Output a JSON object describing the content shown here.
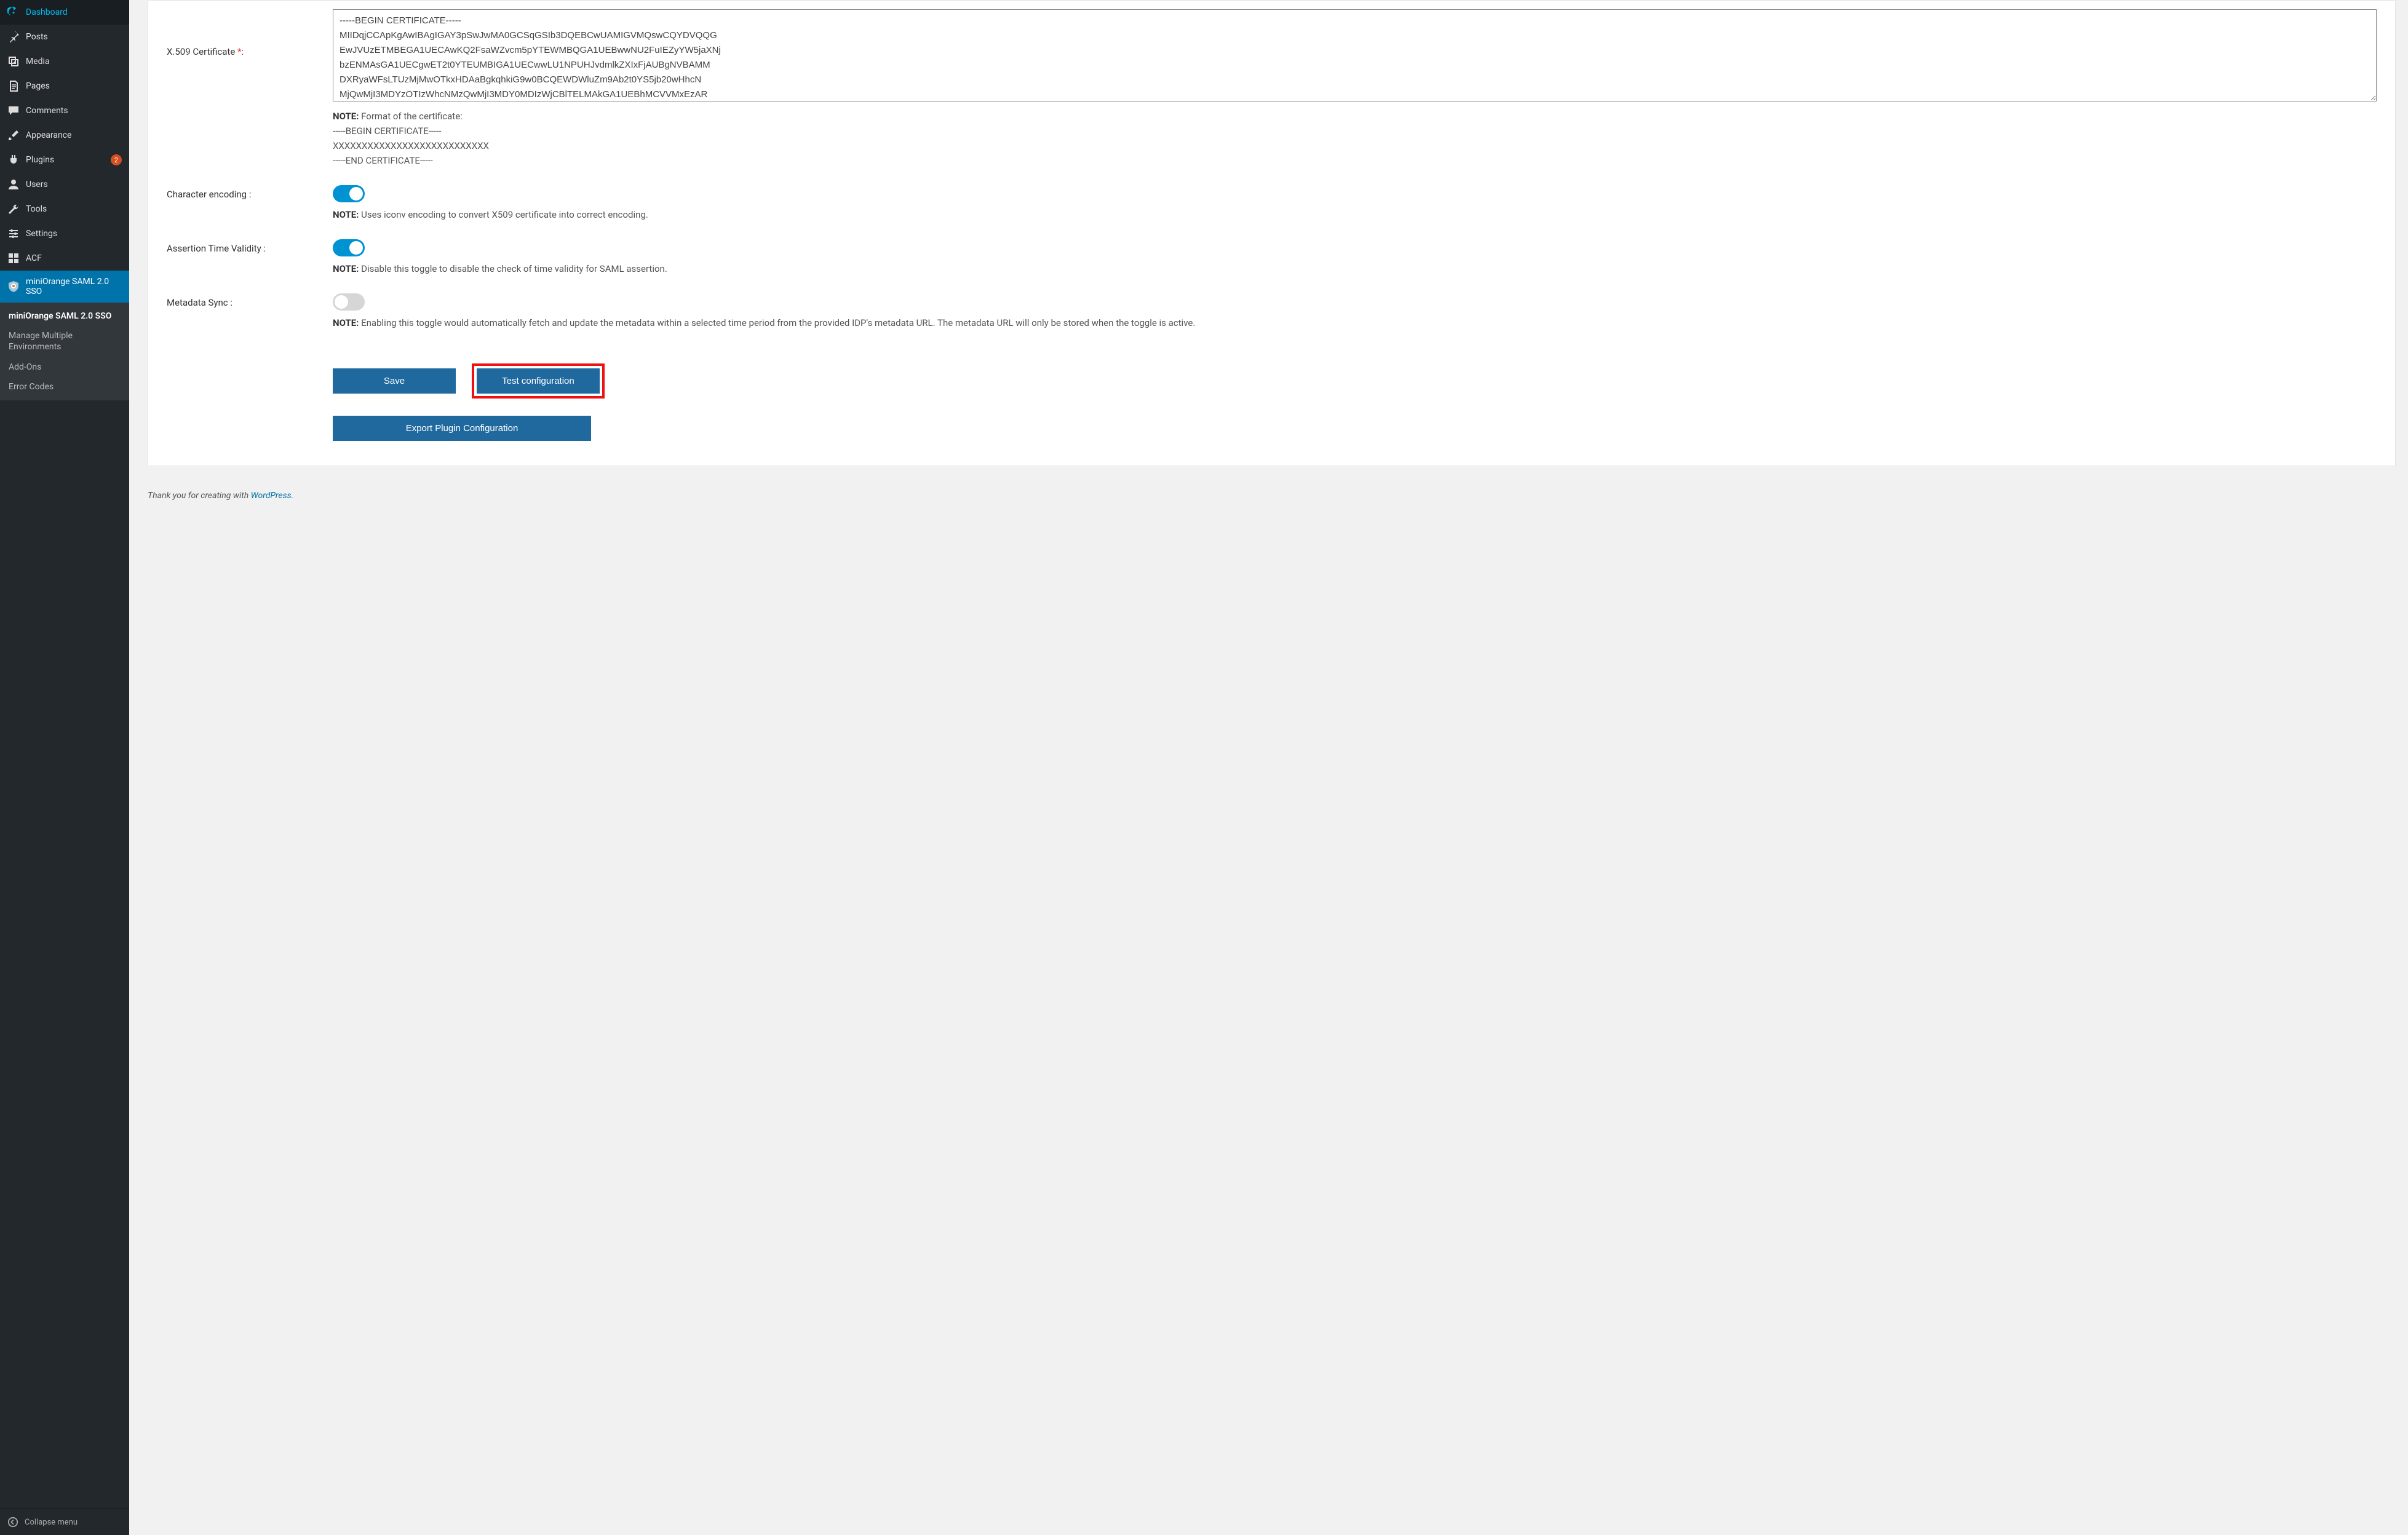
{
  "sidebar": {
    "items": [
      {
        "label": "Dashboard",
        "badge": null
      },
      {
        "label": "Posts",
        "badge": null
      },
      {
        "label": "Media",
        "badge": null
      },
      {
        "label": "Pages",
        "badge": null
      },
      {
        "label": "Comments",
        "badge": null
      },
      {
        "label": "Appearance",
        "badge": null
      },
      {
        "label": "Plugins",
        "badge": "2"
      },
      {
        "label": "Users",
        "badge": null
      },
      {
        "label": "Tools",
        "badge": null
      },
      {
        "label": "Settings",
        "badge": null
      },
      {
        "label": "ACF",
        "badge": null
      },
      {
        "label": "miniOrange SAML 2.0 SSO",
        "badge": null,
        "active": true
      }
    ],
    "submenu": [
      "miniOrange SAML 2.0 SSO",
      "Manage Multiple Environments",
      "Add-Ons",
      "Error Codes"
    ],
    "collapse_label": "Collapse menu"
  },
  "form": {
    "cert_label": "X.509 Certificate ",
    "cert_required_mark": "*",
    "cert_value": "-----BEGIN CERTIFICATE-----\nMIIDqjCCApKgAwIBAgIGAY3pSwJwMA0GCSqGSIb3DQEBCwUAMIGVMQswCQYDVQQG\nEwJVUzETMBEGA1UECAwKQ2FsaWZvcm5pYTEWMBQGA1UEBwwNU2FuIEZyYW5jaXNj\nbzENMAsGA1UECgwET2t0YTEUMBIGA1UECwwLU1NPUHJvdmlkZXIxFjAUBgNVBAMM\nDXRyaWFsLTUzMjMwOTkxHDAaBgkqhkiG9w0BCQEWDWluZm9Ab2t0YS5jb20wHhcN\nMjQwMjI3MDYzOTIzWhcNMzQwMjI3MDY0MDIzWjCBlTELMAkGA1UEBhMCVVMxEzAR",
    "cert_note_prefix": "NOTE:",
    "cert_note_text": " Format of the certificate:",
    "cert_note_l1": "-----BEGIN CERTIFICATE-----",
    "cert_note_l2": "XXXXXXXXXXXXXXXXXXXXXXXXXXX",
    "cert_note_l3": "-----END CERTIFICATE-----",
    "enc_label": "Character encoding :",
    "enc_on": true,
    "enc_note_prefix": "NOTE:",
    "enc_note_text": " Uses iconv encoding to convert X509 certificate into correct encoding.",
    "atv_label": "Assertion Time Validity :",
    "atv_on": true,
    "atv_note_prefix": "NOTE:",
    "atv_note_text": " Disable this toggle to disable the check of time validity for SAML assertion.",
    "msync_label": "Metadata Sync :",
    "msync_on": false,
    "msync_note_prefix": "NOTE:",
    "msync_note_text": " Enabling this toggle would automatically fetch and update the metadata within a selected time period from the provided IDP's metadata URL. The metadata URL will only be stored when the toggle is active.",
    "save_label": "Save",
    "test_label": "Test configuration",
    "export_label": "Export Plugin Configuration"
  },
  "footer": {
    "text_before": "Thank you for creating with ",
    "link_text": "WordPress",
    "text_after": "."
  }
}
